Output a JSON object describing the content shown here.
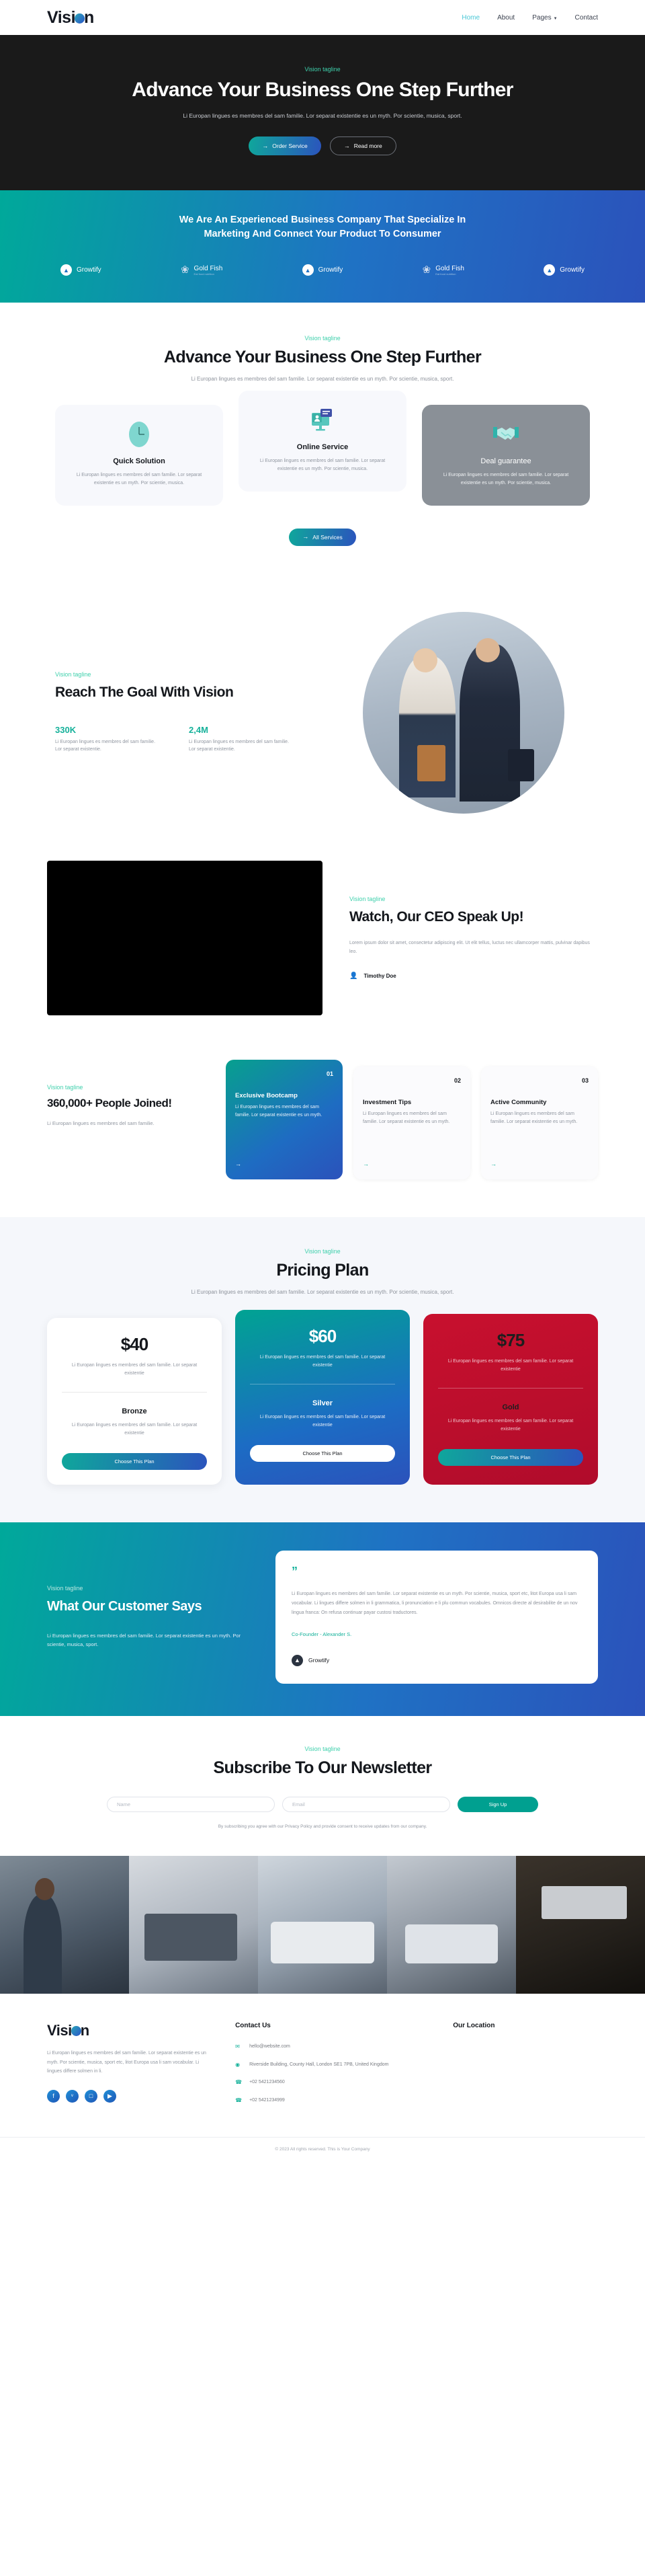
{
  "brand": {
    "name_part1": "Visi",
    "name_part2": "n",
    "logo_dot": "logo-dot"
  },
  "nav": {
    "items": [
      {
        "label": "Home",
        "active": true
      },
      {
        "label": "About",
        "active": false
      },
      {
        "label": "Pages",
        "active": false,
        "has_caret": true
      },
      {
        "label": "Contact",
        "active": false
      }
    ]
  },
  "hero": {
    "tagline": "Vision tagline",
    "title": "Advance Your Business One Step Further",
    "subtitle": "Li Europan lingues es membres del sam familie. Lor separat existentie es un myth. Por scientie, musica, sport.",
    "primary_button": "Order Service",
    "secondary_button": "Read more"
  },
  "banner": {
    "heading": "We Are An Experienced Business Company That Specialize In Marketing And Connect Your Product To Consumer",
    "brands": [
      {
        "name": "Growtify",
        "type": "growtify"
      },
      {
        "name": "Gold Fish",
        "sub": "Eat food nutrition",
        "type": "goldfish"
      },
      {
        "name": "Growtify",
        "type": "growtify"
      },
      {
        "name": "Gold Fish",
        "sub": "Eat food nutrition",
        "type": "goldfish"
      },
      {
        "name": "Growtify",
        "type": "growtify"
      }
    ]
  },
  "services": {
    "tagline": "Vision tagline",
    "title": "Advance Your Business One Step Further",
    "subtitle": "Li Europan lingues es membres del sam familie. Lor separat existentie es un myth. Por scientie, musica, sport.",
    "cards": [
      {
        "icon": "clock-icon",
        "title": "Quick Solution",
        "text": "Li Europan lingues es membres del sam familie. Lor separat existentie es un myth. Por scientie, musica."
      },
      {
        "icon": "online-service-icon",
        "title": "Online Service",
        "text": "Li Europan lingues es membres del sam familie. Lor separat existentie es un myth. Por scientie, musica."
      },
      {
        "icon": "handshake-icon",
        "title": "Deal guarantee",
        "text": "Li Europan lingues es membres del sam familie. Lor separat existentie es un myth. Por scientie, musica."
      }
    ],
    "all_button": "All Services"
  },
  "goal": {
    "tagline": "Vision tagline",
    "title": "Reach The Goal With Vision",
    "stats": [
      {
        "num": "330K",
        "text": "Li Europan lingues es membres del sam familie. Lor separat existentie."
      },
      {
        "num": "2,4M",
        "text": "Li Europan lingues es membres del sam familie. Lor separat existentie."
      }
    ]
  },
  "ceo": {
    "tagline": "Vision tagline",
    "title": "Watch, Our CEO Speak Up!",
    "text": "Lorem ipsum dolor sit amet, consectetur adipiscing elit. Ut elit tellus, luctus nec ullamcorper mattis, pulvinar dapibus leo.",
    "author": "Timothy Doe"
  },
  "joined": {
    "tagline": "Vision tagline",
    "title": "360,000+ People Joined!",
    "text": "Li Europan lingues es membres del sam familie.",
    "cards": [
      {
        "num": "01",
        "title": "Exclusive Bootcamp",
        "text": "Li Europan lingues es membres del sam familie. Lor separat existentie es un myth.",
        "featured": true
      },
      {
        "num": "02",
        "title": "Investment Tips",
        "text": "Li Europan lingues es membres del sam familie. Lor separat existentie es un myth.",
        "featured": false
      },
      {
        "num": "03",
        "title": "Active Community",
        "text": "Li Europan lingues es membres del sam familie. Lor separat existentie es un myth.",
        "featured": false
      }
    ]
  },
  "pricing": {
    "tagline": "Vision tagline",
    "title": "Pricing Plan",
    "subtitle": "Li Europan lingues es membres del sam familie. Lor separat existentie es un myth. Por scientie, musica, sport.",
    "plans": [
      {
        "price": "$40",
        "desc": "Li Europan lingues es membres del sam familie. Lor separat existentie",
        "tier": "Bronze",
        "tier_desc": "Li Europan lingues es membres del sam familie. Lor separat existentie",
        "button": "Choose This Plan"
      },
      {
        "price": "$60",
        "desc": "Li Europan lingues es membres del sam familie. Lor separat existentie",
        "tier": "Silver",
        "tier_desc": "Li Europan lingues es membres del sam familie. Lor separat existentie",
        "button": "Choose This Plan"
      },
      {
        "price": "$75",
        "desc": "Li Europan lingues es membres del sam familie. Lor separat existentie",
        "tier": "Gold",
        "tier_desc": "Li Europan lingues es membres del sam familie. Lor separat existentie",
        "button": "Choose This Plan"
      }
    ]
  },
  "testimonial": {
    "tagline": "Vision tagline",
    "title": "What Our Customer Says",
    "subtitle": "Li Europan lingues es membres del sam familie. Lor separat existentie es un myth. Por scientie, musica, sport.",
    "quote_mark": "”",
    "body": "Li Europan lingues es membres del sam familie. Lor separat existentie es un myth. Por scientie, musica, sport etc, litot Europa usa li sam vocabular. Li lingues differe solmen in li grammatica, li pronunciation e li plu commun vocabules. Omnicos directe al desirabilite de un nov lingua franca: On refusa continuar payar custosi traductores.",
    "role": "Co-Founder - ",
    "person": "Alexander S.",
    "company": "Growtify"
  },
  "newsletter": {
    "tagline": "Vision tagline",
    "title": "Subscribe To Our Newsletter",
    "name_placeholder": "Name",
    "email_placeholder": "Email",
    "name_value": "",
    "email_value": "",
    "button": "Sign Up",
    "note": "By subscribing you agree with our Privacy Policy and provide consent to receive updates from our company."
  },
  "footer": {
    "about": "Li Europan lingues es membres del sam familie. Lor separat existentie es un myth. Por scientie, musica, sport etc, litot Europa usa li sam vocabular. Li lingues differe solmen in li.",
    "socials": [
      {
        "icon": "facebook-icon",
        "glyph": "f"
      },
      {
        "icon": "twitter-icon",
        "glyph": "ᵛ"
      },
      {
        "icon": "instagram-icon",
        "glyph": "□"
      },
      {
        "icon": "youtube-icon",
        "glyph": "▶"
      }
    ],
    "contact_title": "Contact Us",
    "contacts": [
      {
        "icon": "mail-icon",
        "glyph": "✉",
        "text": "hello@website.com"
      },
      {
        "icon": "location-icon",
        "glyph": "◉",
        "text": "Riverside Building, County Hall, London SE1 7PB, United Kingdom"
      },
      {
        "icon": "phone-icon",
        "glyph": "☎",
        "text": "+02 5421234560"
      },
      {
        "icon": "phone-icon",
        "glyph": "☎",
        "text": "+02 5421234999"
      }
    ],
    "location_title": "Our Location",
    "copyright": "© 2023 All rights reserved. This is Your Company"
  },
  "colors": {
    "accent_teal": "#15b19a",
    "accent_mint": "#3fd0ac",
    "brand_blue": "#2b52bb",
    "dark": "#1a1a1a",
    "gold_red": "#c8102e"
  }
}
